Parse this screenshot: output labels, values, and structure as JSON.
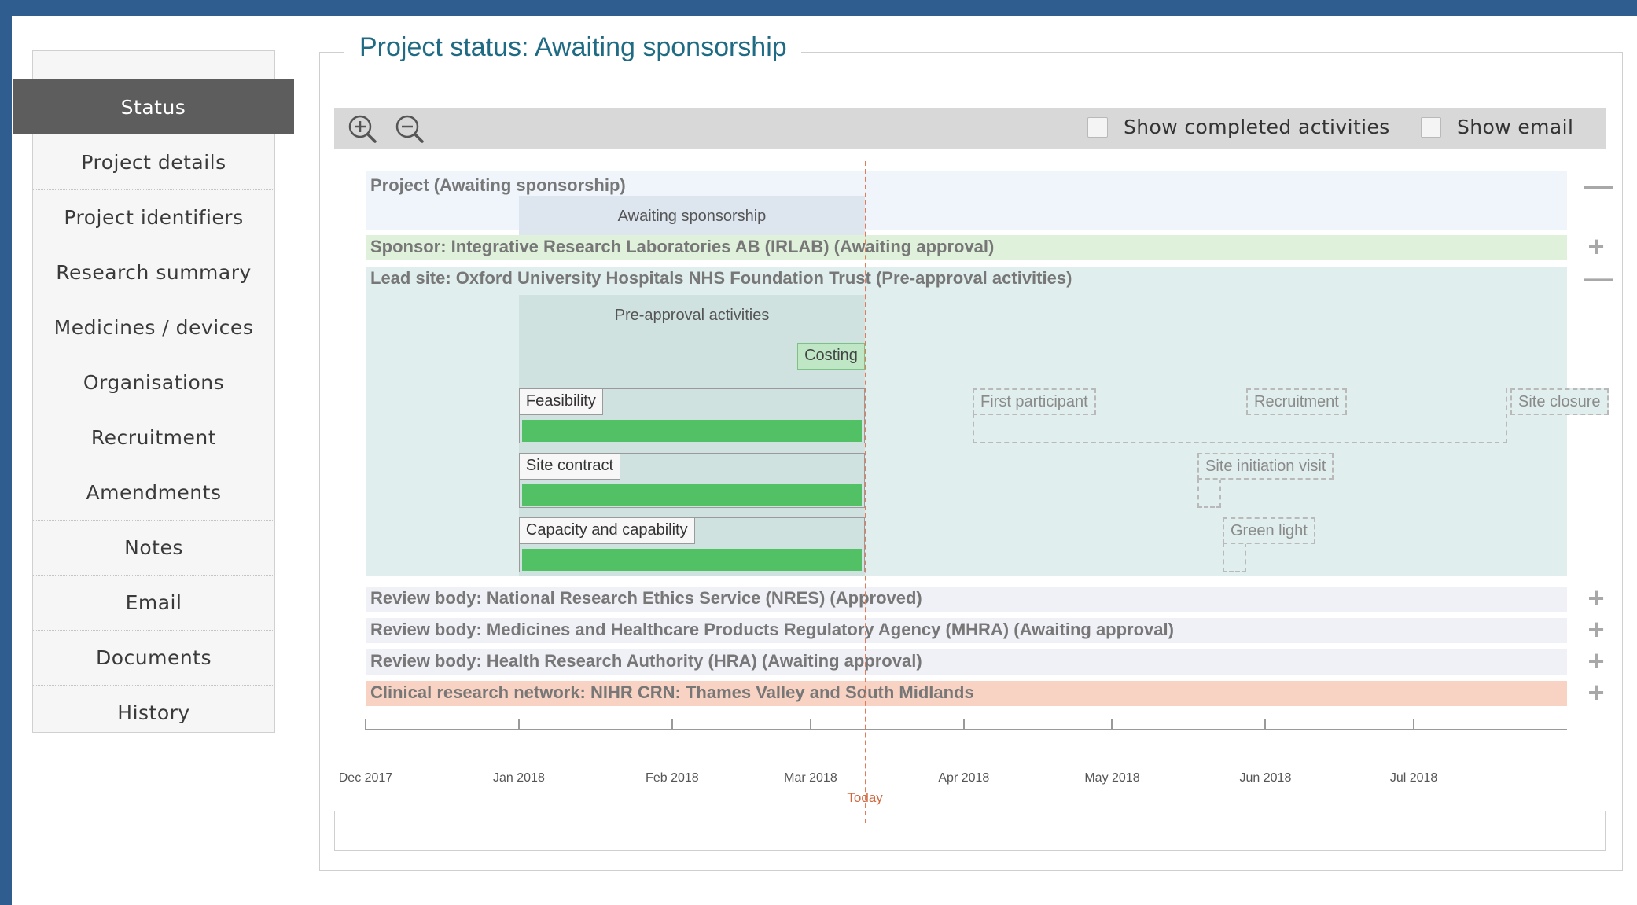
{
  "sidebar": {
    "items": [
      {
        "label": "Status",
        "active": true
      },
      {
        "label": "Project details"
      },
      {
        "label": "Project identifiers"
      },
      {
        "label": "Research summary"
      },
      {
        "label": "Medicines / devices"
      },
      {
        "label": "Organisations"
      },
      {
        "label": "Recruitment"
      },
      {
        "label": "Amendments"
      },
      {
        "label": "Notes"
      },
      {
        "label": "Email"
      },
      {
        "label": "Documents"
      },
      {
        "label": "History"
      }
    ]
  },
  "main": {
    "title": "Project status: Awaiting sponsorship",
    "toolbar": {
      "zoom_in_icon": "zoom-in-icon",
      "zoom_out_icon": "zoom-out-icon",
      "show_completed_label": "Show completed activities",
      "show_completed_checked": false,
      "show_email_label": "Show email",
      "show_email_checked": false
    }
  },
  "timeline": {
    "start": "2017-12-01",
    "end": "2018-08-01",
    "today": "2018-03-12",
    "today_label": "Today",
    "months": [
      "Dec 2017",
      "Jan 2018",
      "Feb 2018",
      "Mar 2018",
      "Apr 2018",
      "May 2018",
      "Jun 2018",
      "Jul 2018"
    ],
    "rows": [
      {
        "title": "Project (Awaiting sponsorship)",
        "expanded": true,
        "toggle": "—",
        "color": "#eff5fb",
        "phase": {
          "label": "Awaiting sponsorship",
          "start": "2018-01-01",
          "end": "2018-03-12",
          "color": "#dde6ef"
        }
      },
      {
        "title": "Sponsor: Integrative Research Laboratories AB (IRLAB) (Awaiting approval)",
        "expanded": false,
        "toggle": "+",
        "color": "#dff0db"
      },
      {
        "title": "Lead site: Oxford University Hospitals NHS Foundation Trust (Pre-approval activities)",
        "expanded": true,
        "toggle": "—",
        "color": "#e0efee",
        "phase": {
          "label": "Pre-approval activities",
          "start": "2018-01-01",
          "end": "2018-03-12",
          "color": "#cfe2df"
        },
        "milestone": {
          "label": "Costing",
          "date": "2018-03-12"
        },
        "activities": [
          {
            "label": "Feasibility",
            "start": "2018-01-01",
            "end": "2018-03-12",
            "progress": 1.0
          },
          {
            "label": "Site contract",
            "start": "2018-01-01",
            "end": "2018-03-12",
            "progress": 1.0
          },
          {
            "label": "Capacity and capability",
            "start": "2018-01-01",
            "end": "2018-03-12",
            "progress": 1.0
          }
        ],
        "planned": [
          {
            "label": "First participant"
          },
          {
            "label": "Recruitment"
          },
          {
            "label": "Site closure"
          },
          {
            "label": "Site initiation visit"
          },
          {
            "label": "Green light"
          }
        ]
      },
      {
        "title": "Review body: National Research Ethics Service (NRES) (Approved)",
        "expanded": false,
        "toggle": "+",
        "color": "#f0f0f7"
      },
      {
        "title": "Review body: Medicines and Healthcare Products Regulatory Agency (MHRA) (Awaiting approval)",
        "expanded": false,
        "toggle": "+",
        "color": "#f0f0f7"
      },
      {
        "title": "Review body: Health Research Authority (HRA) (Awaiting approval)",
        "expanded": false,
        "toggle": "+",
        "color": "#f0f0f7"
      },
      {
        "title": "Clinical research network: NIHR CRN: Thames Valley and South Midlands",
        "expanded": false,
        "toggle": "+",
        "color": "#f8d3c4"
      }
    ]
  }
}
